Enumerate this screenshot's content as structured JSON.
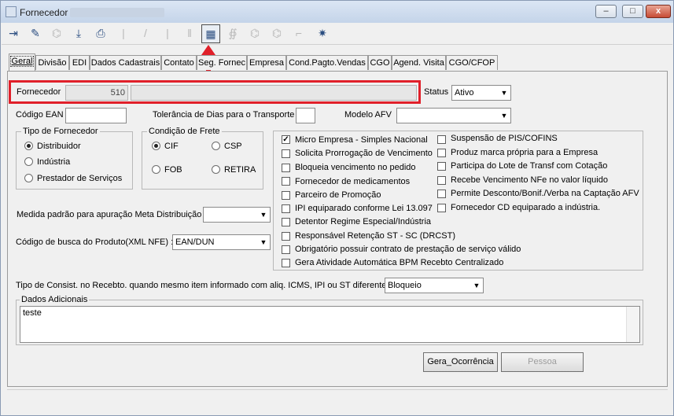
{
  "window": {
    "title": "Fornecedor",
    "minimize": "–",
    "maximize": "□",
    "close": "x"
  },
  "toolbar": [
    {
      "icon": "exit-door-icon",
      "glyph": "⇥",
      "enabled": true
    },
    {
      "icon": "eraser-icon",
      "glyph": "✎",
      "enabled": true
    },
    {
      "icon": "hierarchy-icon",
      "glyph": "⌬",
      "enabled": false
    },
    {
      "icon": "download-tray-icon",
      "glyph": "⤓",
      "enabled": true
    },
    {
      "icon": "print-icon",
      "glyph": "⎙",
      "enabled": true
    },
    {
      "icon": "first-record-icon",
      "glyph": "|",
      "enabled": false
    },
    {
      "icon": "prev-record-icon",
      "glyph": "/",
      "enabled": false
    },
    {
      "icon": "next-record-icon",
      "glyph": "|",
      "enabled": false
    },
    {
      "icon": "last-record-icon",
      "glyph": "‖",
      "enabled": false
    },
    {
      "icon": "table-grid-icon",
      "glyph": "▦",
      "enabled": true,
      "selected": true
    },
    {
      "icon": "lookup-icon",
      "glyph": "∯",
      "enabled": false
    },
    {
      "icon": "tree-expand-icon",
      "glyph": "⌬",
      "enabled": false
    },
    {
      "icon": "tree-collapse-icon",
      "glyph": "⌬",
      "enabled": false
    },
    {
      "icon": "tree-link-icon",
      "glyph": "⌐",
      "enabled": false
    },
    {
      "icon": "grid-sparkle-icon",
      "glyph": "✷",
      "enabled": true
    }
  ],
  "tabs": [
    "Geral",
    "Divisão",
    "EDI",
    "Dados Cadastrais",
    "Contato",
    "Seg. Fornec",
    "Empresa",
    "Cond.Pagto.Vendas",
    "CGO",
    "Agend. Visita",
    "CGO/CFOP"
  ],
  "fornecedor": {
    "label": "Fornecedor",
    "code": "510",
    "name": ""
  },
  "status": {
    "label": "Status",
    "value": "Ativo"
  },
  "codigo_ean": {
    "label": "Código EAN",
    "value": ""
  },
  "tolerancia": {
    "label": "Tolerância de Dias para o Transporte",
    "value": ""
  },
  "modelo_afv": {
    "label": "Modelo AFV",
    "value": ""
  },
  "tipo_fornecedor": {
    "title": "Tipo de Fornecedor",
    "options": [
      {
        "label": "Distribuidor",
        "checked": true
      },
      {
        "label": "Indústria",
        "checked": false
      },
      {
        "label": "Prestador de Serviços",
        "checked": false
      }
    ]
  },
  "condicao_frete": {
    "title": "Condição de Frete",
    "options": [
      {
        "label": "CIF",
        "checked": true
      },
      {
        "label": "CSP",
        "checked": false
      },
      {
        "label": "FOB",
        "checked": false
      },
      {
        "label": "RETIRA",
        "checked": false
      }
    ]
  },
  "checks_left": [
    {
      "label": "Micro Empresa - Simples Nacional",
      "checked": true
    },
    {
      "label": "Solicita Prorrogação de Vencimento",
      "checked": false
    },
    {
      "label": "Bloqueia vencimento no pedido",
      "checked": false
    },
    {
      "label": "Fornecedor de medicamentos",
      "checked": false
    },
    {
      "label": "Parceiro de Promoção",
      "checked": false
    },
    {
      "label": "IPI equiparado conforme Lei 13.097",
      "checked": false
    },
    {
      "label": "Detentor Regime Especial/Indústria",
      "checked": false
    },
    {
      "label": "Responsável Retenção ST - SC (DRCST)",
      "checked": false
    },
    {
      "label": "Obrigatório possuir contrato de prestação de serviço válido",
      "checked": false
    },
    {
      "label": "Gera Atividade Automática BPM Recebto Centralizado",
      "checked": false
    }
  ],
  "checks_right": [
    {
      "label": "Suspensão de PIS/COFINS",
      "checked": false
    },
    {
      "label": "Produz marca própria para a Empresa",
      "checked": false
    },
    {
      "label": "Participa do Lote de Transf com Cotação",
      "checked": false
    },
    {
      "label": "Recebe Vencimento NFe no valor líquido",
      "checked": false
    },
    {
      "label": "Permite Desconto/Bonif./Verba na Captação AFV",
      "checked": false
    },
    {
      "label": "Fornecedor CD equiparado a indústria.",
      "checked": false
    }
  ],
  "medida_padrao": {
    "label": "Medida padrão para apuração Meta Distribuição",
    "value": ""
  },
  "codigo_busca": {
    "label": "Código de busca do Produto(XML NFE) :",
    "value": "EAN/DUN"
  },
  "tipo_consist": {
    "label": "Tipo de Consist. no Recebto. quando mesmo item informado com aliq. ICMS, IPI ou ST diferentes:",
    "value": "Bloqueio"
  },
  "dados_adicionais": {
    "title": "Dados Adicionais",
    "text": "teste"
  },
  "buttons": {
    "gera_ocorrencia": "Gera_Ocorrência",
    "pessoa": "Pessoa"
  },
  "colors": {
    "highlight": "#e0202a",
    "window_bg": "#f0f0f0"
  }
}
